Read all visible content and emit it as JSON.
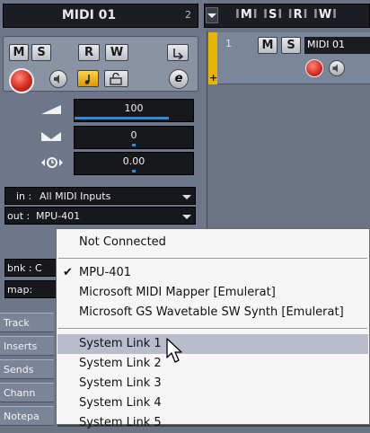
{
  "channel": {
    "name": "MIDI 01",
    "name_badge": "2",
    "buttons": {
      "mute": "M",
      "solo": "S",
      "read": "R",
      "write": "W",
      "edit": "e"
    },
    "volume": "100",
    "pan": "0",
    "delay": "0.00",
    "input_routing": {
      "label": "in :",
      "value": "All MIDI Inputs"
    },
    "output_routing": {
      "label": "out :",
      "value": "MPU-401"
    },
    "bank_label": "bnk : C",
    "map_label": "map:",
    "sections": [
      "Track",
      "Inserts",
      "Sends",
      "Chann",
      "Notepa"
    ]
  },
  "track_list": {
    "header_buttons": [
      "M",
      "S",
      "R",
      "W"
    ],
    "tracks": [
      {
        "number": "1",
        "mute": "M",
        "solo": "S",
        "name": "MIDI 01"
      }
    ]
  },
  "output_menu": {
    "items": [
      {
        "label": "Not Connected",
        "checked": false,
        "highlighted": false
      },
      {
        "label": "MPU-401",
        "checked": true,
        "highlighted": false
      },
      {
        "label": "Microsoft MIDI Mapper [Emulerat]",
        "checked": false,
        "highlighted": false
      },
      {
        "label": "Microsoft GS Wavetable SW Synth [Emulerat]",
        "checked": false,
        "highlighted": false
      },
      {
        "label": "System Link 1",
        "checked": false,
        "highlighted": true
      },
      {
        "label": "System Link 2",
        "checked": false,
        "highlighted": false
      },
      {
        "label": "System Link 3",
        "checked": false,
        "highlighted": false
      },
      {
        "label": "System Link 4",
        "checked": false,
        "highlighted": false
      },
      {
        "label": "System Link 5",
        "checked": false,
        "highlighted": false
      }
    ]
  },
  "colors": {
    "accent_blue": "#2f8ad9",
    "record_red": "#d42a20",
    "track_bar_yellow": "#e8b400",
    "menu_highlight": "#b8bccb"
  }
}
